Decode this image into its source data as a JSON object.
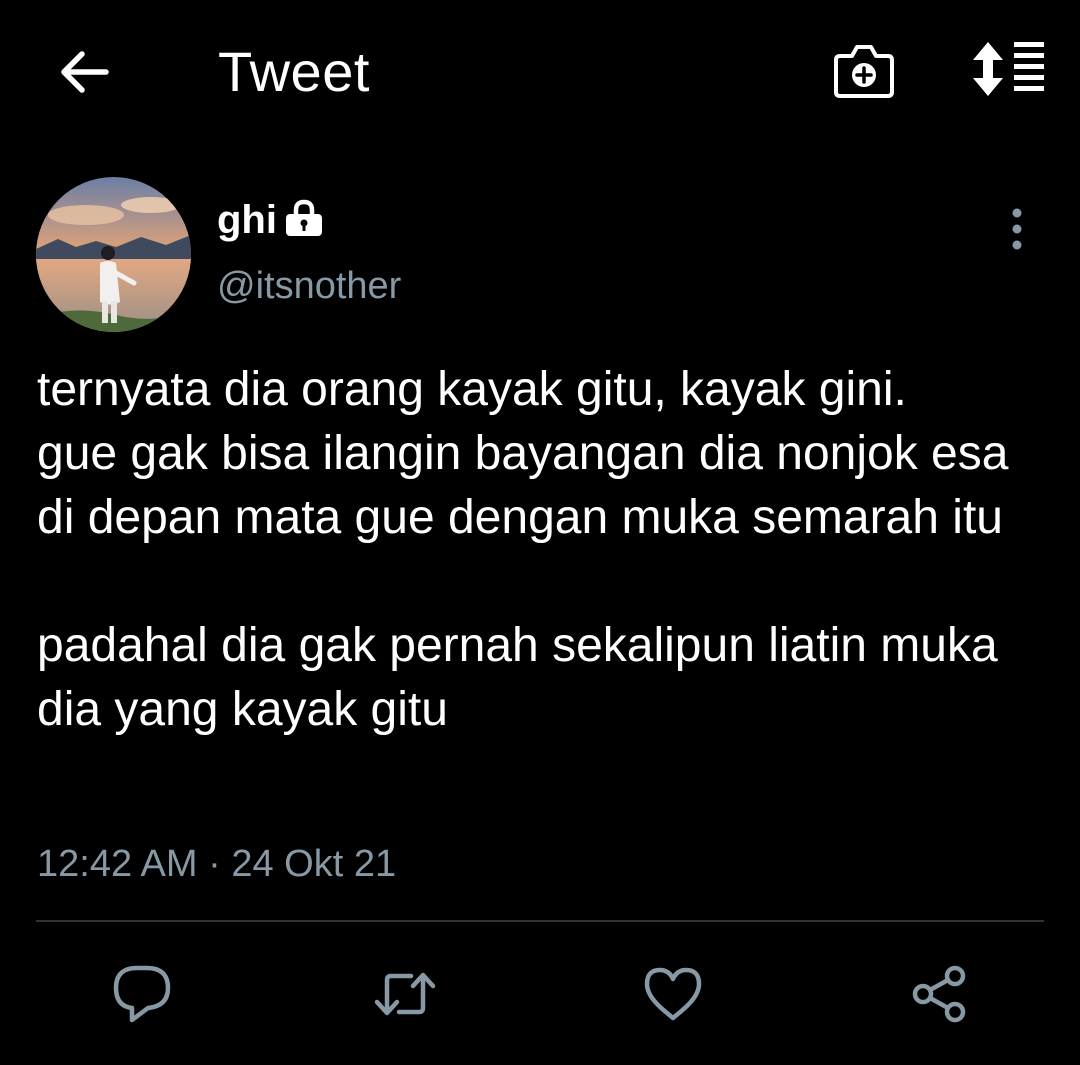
{
  "header": {
    "back_icon": "arrow-left-icon",
    "title": "Tweet",
    "camera_icon": "camera-plus-icon",
    "sort_icon": "sort-list-icon"
  },
  "tweet": {
    "author": {
      "display_name": "ghi",
      "handle": "@itsnother",
      "protected": true,
      "lock_icon": "lock-icon"
    },
    "more_icon": "more-vertical-icon",
    "text": "ternyata dia orang kayak gitu, kayak gini.\ngue gak bisa ilangin bayangan dia nonjok esa di depan mata gue dengan muka semarah itu\n\npadahal dia gak pernah sekalipun liatin muka dia yang kayak gitu",
    "timestamp": "12:42 AM · 24 Okt 21"
  },
  "actions": [
    {
      "name": "reply",
      "icon": "reply-icon"
    },
    {
      "name": "retweet",
      "icon": "retweet-icon"
    },
    {
      "name": "like",
      "icon": "heart-icon"
    },
    {
      "name": "share",
      "icon": "share-icon"
    }
  ],
  "colors": {
    "background": "#000000",
    "text_primary": "#ffffff",
    "text_secondary": "#8899a6",
    "divider": "#2f3336"
  }
}
